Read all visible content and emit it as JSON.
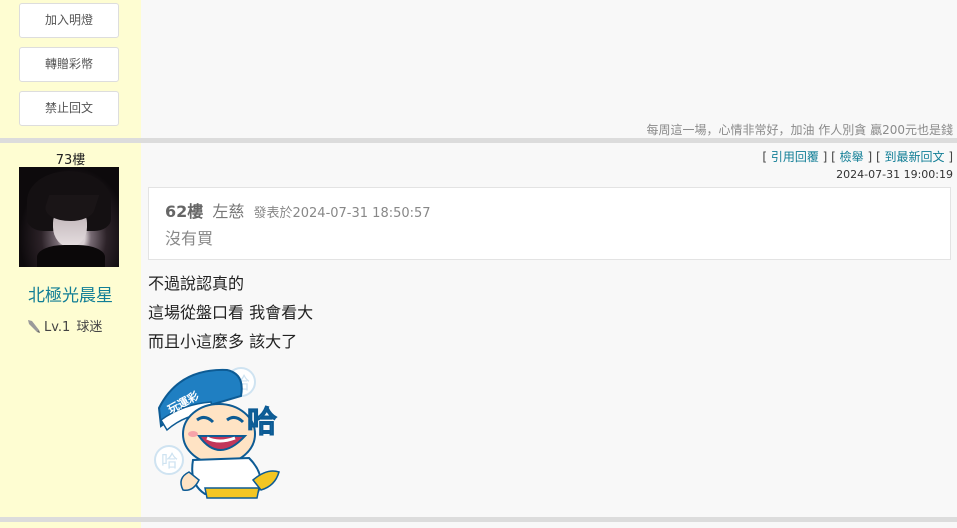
{
  "prev_post": {
    "buttons": [
      "加入明燈",
      "轉贈彩幣",
      "禁止回文"
    ],
    "signature": "每周這一場，心情非常好，加油 作人別貪 贏200元也是錢"
  },
  "post": {
    "floor": "73樓",
    "author": {
      "nickname": "北極光晨星",
      "level": "Lv.1",
      "title": "球迷"
    },
    "tools": {
      "open": "[ ",
      "quote": "引用回覆",
      "sep1": " ] [ ",
      "report": "檢舉",
      "sep2": " ] [ ",
      "latest": "到最新回文",
      "close": " ]"
    },
    "timestamp": "2024-07-31 19:00:19",
    "quote": {
      "floor": "62樓",
      "author": "左慈",
      "meta": "發表於2024-07-31 18:50:57",
      "text": "沒有買"
    },
    "lines": [
      "不過說認真的",
      "這場從盤口看 我會看大",
      "而且小這麼多 該大了"
    ],
    "sticker": {
      "label": "玩運彩",
      "big": "哈",
      "small1": "哈",
      "small2": "哈"
    }
  },
  "colors": {
    "sidebar_bg": "#fefdd2",
    "link": "#117e96",
    "divider": "#dcdcdc"
  },
  "icons": {
    "level": "pen-icon"
  }
}
